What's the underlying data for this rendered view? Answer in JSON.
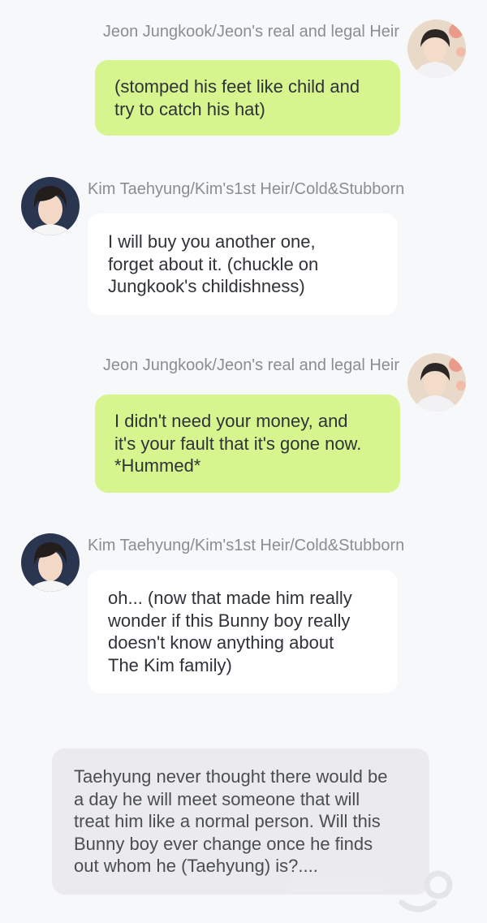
{
  "characters": {
    "jungkook": {
      "name": "Jeon Jungkook/Jeon's real and legal Heir",
      "avatar_icon": "avatar-jungkook"
    },
    "taehyung": {
      "name": "Kim Taehyung/Kim's1st Heir/Cold&Stubborn",
      "avatar_icon": "avatar-taehyung"
    }
  },
  "messages": [
    {
      "speaker": "jungkook",
      "lines": [
        "(stomped his feet like child and",
        "try to catch his hat)"
      ]
    },
    {
      "speaker": "taehyung",
      "lines": [
        "I will buy you another one,",
        "forget about it. (chuckle on",
        "Jungkook's childishness)"
      ]
    },
    {
      "speaker": "jungkook",
      "lines": [
        "I didn't need your money, and",
        "it's your fault that it's gone now.",
        "*Hummed*"
      ]
    },
    {
      "speaker": "taehyung",
      "lines": [
        "oh... (now that made him really",
        "wonder if this Bunny boy really",
        "doesn't know anything about",
        "The Kim family)"
      ]
    }
  ],
  "narration": {
    "lines": [
      "Taehyung never thought there would be",
      "a day he will meet someone that will",
      "treat him like a normal person. Will this",
      "Bunny boy ever change once he finds",
      "out whom he (Taehyung) is?...."
    ]
  },
  "colors": {
    "background": "#f7f8fa",
    "right_bubble": "#d6f58f",
    "left_bubble": "#ffffff",
    "narration_bubble": "#ebebed",
    "speaker_name": "#8a8d92"
  },
  "watermark_icon": "webtoon-watermark"
}
